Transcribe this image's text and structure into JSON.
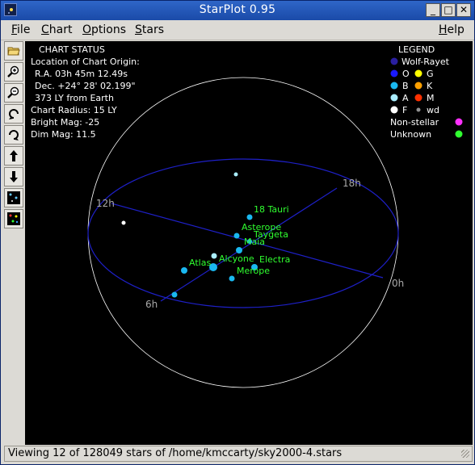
{
  "window": {
    "title": "StarPlot 0.95",
    "controls": {
      "minimize": "_",
      "maximize": "□",
      "close": "✕"
    }
  },
  "menu": {
    "items": [
      {
        "label": "File"
      },
      {
        "label": "Chart"
      },
      {
        "label": "Options"
      },
      {
        "label": "Stars"
      },
      {
        "label": "Help"
      }
    ]
  },
  "toolbar": {
    "buttons": [
      {
        "name": "open-file-icon"
      },
      {
        "name": "zoom-in-icon"
      },
      {
        "name": "zoom-out-icon"
      },
      {
        "name": "rotate-left-icon"
      },
      {
        "name": "rotate-right-icon"
      },
      {
        "name": "arrow-up-icon"
      },
      {
        "name": "arrow-down-icon"
      },
      {
        "name": "star-field-icon"
      },
      {
        "name": "color-stars-icon"
      }
    ]
  },
  "chart_status": {
    "heading": "CHART STATUS",
    "location_label": "Location of Chart Origin:",
    "ra": "R.A. 03h 45m 12.49s",
    "dec": "Dec. +24° 28' 02.199\"",
    "distance": "373 LY from Earth",
    "radius": "Chart Radius: 15 LY",
    "bright_mag": "Bright Mag: -25",
    "dim_mag": "Dim Mag: 11.5"
  },
  "legend": {
    "heading": "LEGEND",
    "wolf_rayet": {
      "label": "Wolf-Rayet",
      "color": "#2a1fa0"
    },
    "rows": [
      [
        {
          "label": "O",
          "color": "#1a1aff"
        },
        {
          "label": "G",
          "color": "#ffff00"
        }
      ],
      [
        {
          "label": "B",
          "color": "#1ab8f0"
        },
        {
          "label": "K",
          "color": "#ffa000"
        }
      ],
      [
        {
          "label": "A",
          "color": "#aaeeff"
        },
        {
          "label": "M",
          "color": "#ff3000"
        }
      ],
      [
        {
          "label": "F",
          "color": "#ffffff"
        },
        {
          "label": "wd",
          "color": "#909090"
        }
      ]
    ],
    "non_stellar": {
      "label": "Non-stellar",
      "color": "#ff30ff"
    },
    "unknown": {
      "label": "Unknown",
      "color": "#30ff30"
    }
  },
  "axis_labels": {
    "h0": "0h",
    "h6": "6h",
    "h12": "12h",
    "h18": "18h"
  },
  "stars": [
    {
      "name": "18 Tauri",
      "color": "#1ab8f0"
    },
    {
      "name": "Asterope",
      "color": "#1ab8f0"
    },
    {
      "name": "Taygeta",
      "color": "#1ab8f0"
    },
    {
      "name": "Maia",
      "color": "#1ab8f0"
    },
    {
      "name": "Alcyone",
      "color": "#1ab8f0"
    },
    {
      "name": "Electra",
      "color": "#1ab8f0"
    },
    {
      "name": "Atlas",
      "color": "#1ab8f0"
    },
    {
      "name": "Merope",
      "color": "#1ab8f0"
    }
  ],
  "colors": {
    "star_label": "#30ff30",
    "grid": "#1e20c8",
    "sphere_outline": "#ffffff",
    "chart_background": "#000000",
    "info_text": "#ffffff"
  },
  "status_bar": {
    "text": "Viewing 12 of 128049 stars of /home/kmccarty/sky2000-4.stars"
  }
}
